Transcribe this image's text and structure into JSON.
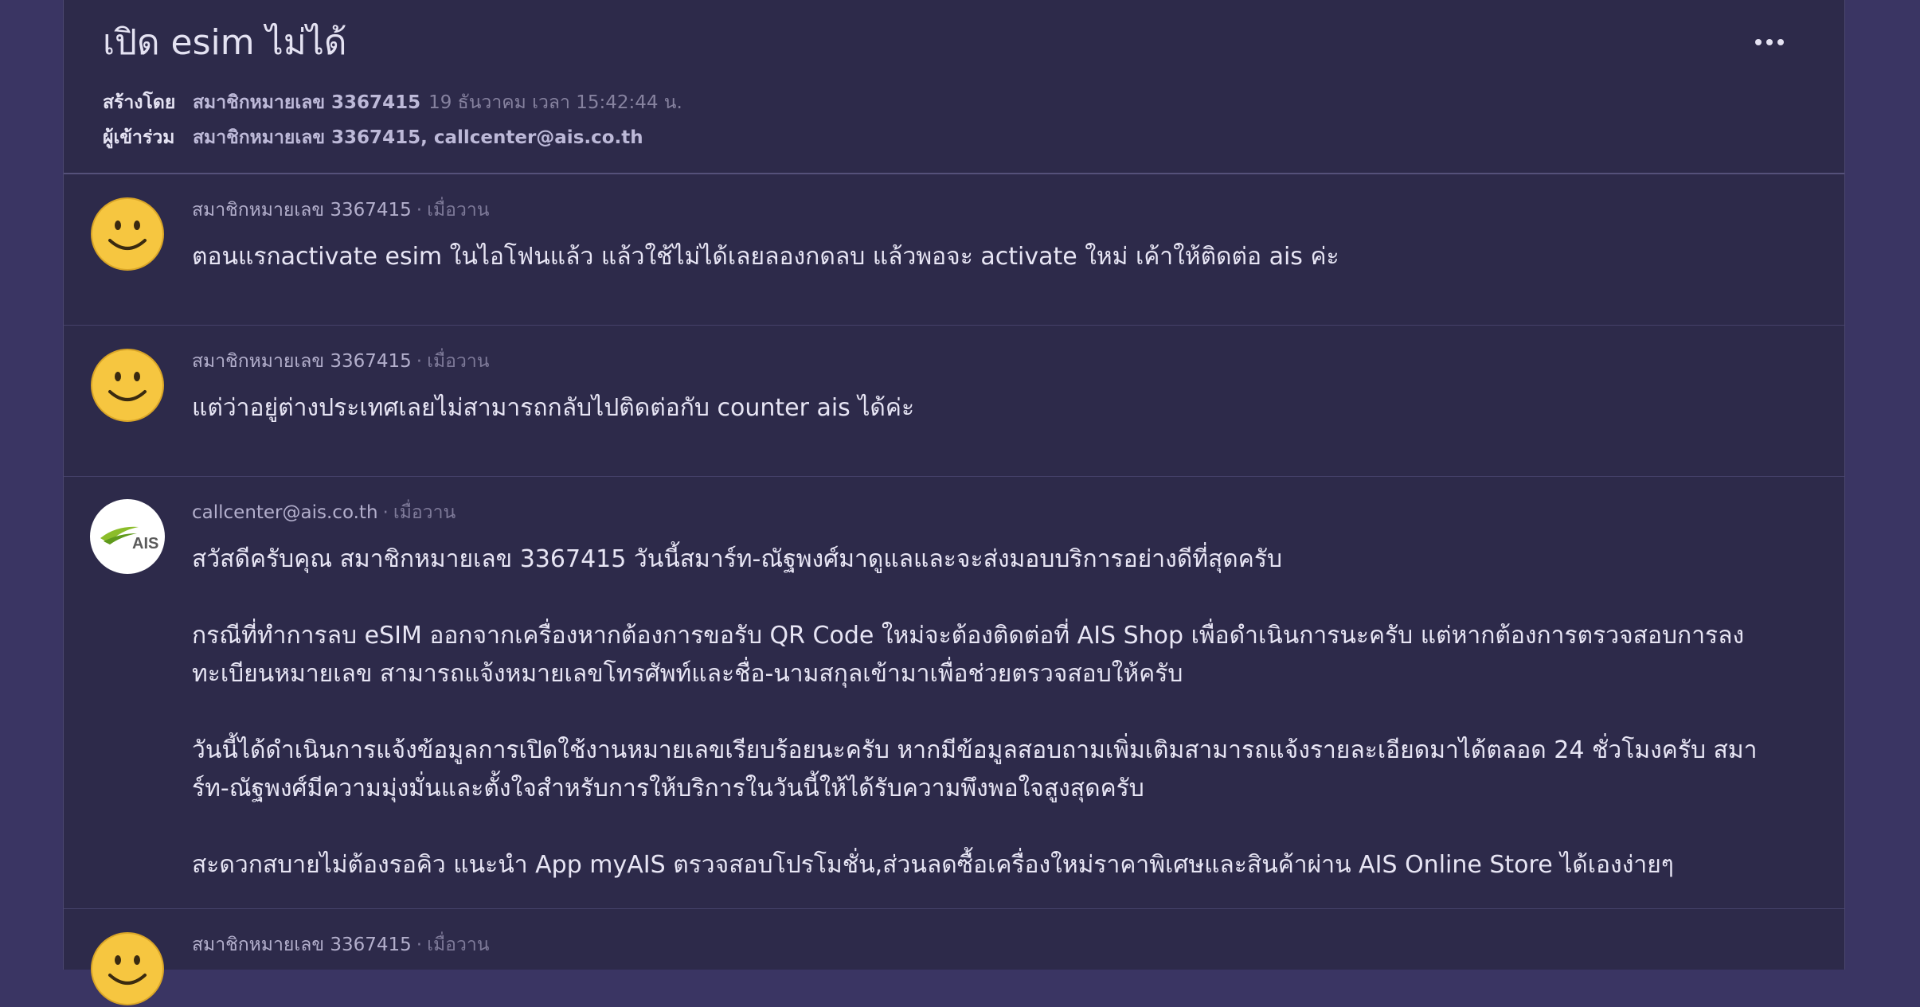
{
  "thread": {
    "title": "เปิด esim ไม่ได้",
    "created_label": "สร้างโดย",
    "creator": "สมาชิกหมายเลข 3367415",
    "created_time": "19 ธันวาคม เวลา 15:42:44 น.",
    "participants_label": "ผู้เข้าร่วม",
    "participants": "สมาชิกหมายเลข 3367415, callcenter@ais.co.th"
  },
  "comments": [
    {
      "author": "สมาชิกหมายเลข 3367415",
      "separator": "·",
      "time": "เมื่อวาน",
      "avatar_icon": "smiley-icon",
      "paragraphs": [
        "ตอนแรกactivate esim ในไอโฟนแล้ว แล้วใช้ไม่ได้เลยลองกดลบ แล้วพอจะ activate ใหม่ เค้าให้ติดต่อ ais ค่ะ"
      ]
    },
    {
      "author": "สมาชิกหมายเลข 3367415",
      "separator": "·",
      "time": "เมื่อวาน",
      "avatar_icon": "smiley-icon",
      "paragraphs": [
        "แต่ว่าอยู่ต่างประเทศเลยไม่สามารถกลับไปติดต่อกับ counter ais ได้ค่ะ"
      ]
    },
    {
      "author": "callcenter@ais.co.th",
      "separator": "·",
      "time": "เมื่อวาน",
      "avatar_icon": "ais-logo-icon",
      "avatar_text": "AIS",
      "paragraphs": [
        "สวัสดีครับคุณ สมาชิกหมายเลข 3367415 วันนี้สมาร์ท-ณัฐพงศ์มาดูแลและจะส่งมอบบริการอย่างดีที่สุดครับ",
        "กรณีที่ทำการลบ eSIM ออกจากเครื่องหากต้องการขอรับ QR Code ใหม่จะต้องติดต่อที่ AIS Shop เพื่อดำเนินการนะครับ แต่หากต้องการตรวจสอบการลงทะเบียนหมายเลข สามารถแจ้งหมายเลขโทรศัพท์และชื่อ-นามสกุลเข้ามาเพื่อช่วยตรวจสอบให้ครับ",
        "วันนี้ได้ดำเนินการแจ้งข้อมูลการเปิดใช้งานหมายเลขเรียบร้อยนะครับ หากมีข้อมูลสอบถามเพิ่มเติมสามารถแจ้งรายละเอียดมาได้ตลอด 24 ชั่วโมงครับ สมาร์ท-ณัฐพงศ์มีความมุ่งมั่นและตั้งใจสำหรับการให้บริการในวันนี้ให้ได้รับความพึงพอใจสูงสุดครับ",
        "สะดวกสบายไม่ต้องรอคิว แนะนำ App myAIS ตรวจสอบโปรโมชั่น,ส่วนลดซื้อเครื่องใหม่ราคาพิเศษและสินค้าผ่าน AIS Online Store ได้เองง่ายๆ"
      ]
    },
    {
      "author": "สมาชิกหมายเลข 3367415",
      "separator": "·",
      "time": "เมื่อวาน",
      "avatar_icon": "smiley-icon",
      "paragraphs": []
    }
  ],
  "colors": {
    "background": "#3a3563",
    "panel": "#2d2a4a",
    "smiley_fill": "#f6c640"
  }
}
